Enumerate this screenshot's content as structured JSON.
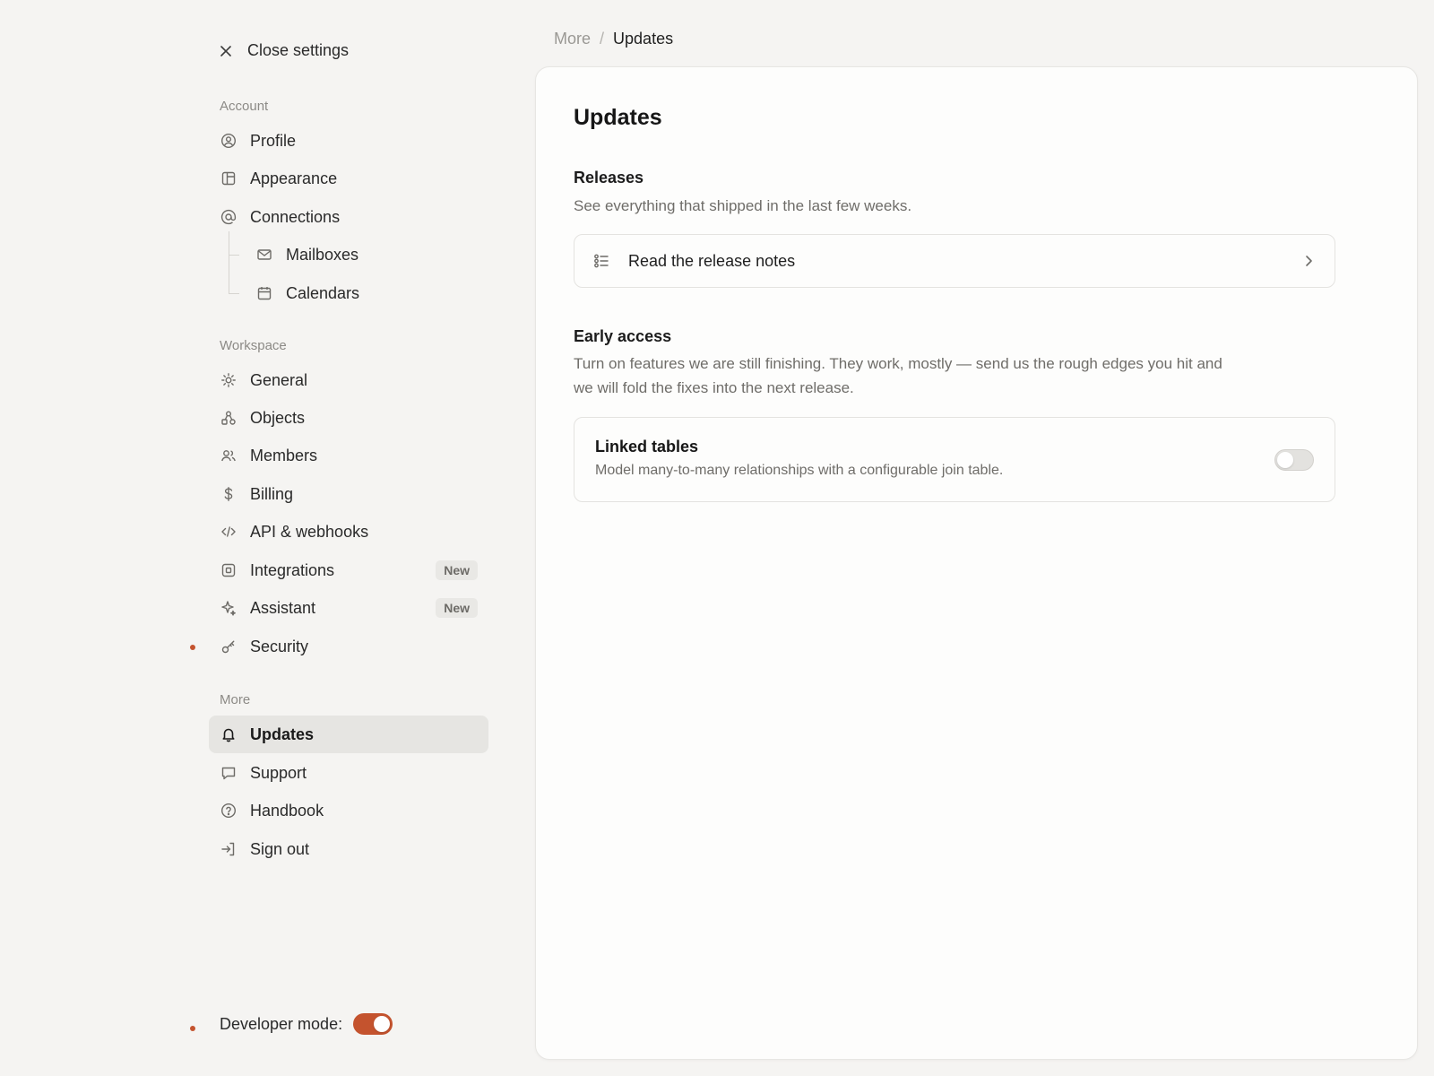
{
  "sidebar": {
    "close_label": "Close settings",
    "sections": {
      "account": "Account",
      "workspace": "Workspace",
      "more": "More"
    },
    "items": {
      "profile": "Profile",
      "appearance": "Appearance",
      "connections": "Connections",
      "mailboxes": "Mailboxes",
      "calendars": "Calendars",
      "general": "General",
      "objects": "Objects",
      "members": "Members",
      "billing": "Billing",
      "api": "API & webhooks",
      "integrations": "Integrations",
      "assistant": "Assistant",
      "security": "Security",
      "updates": "Updates",
      "support": "Support",
      "handbook": "Handbook",
      "signout": "Sign out"
    },
    "badges": {
      "integrations": "New",
      "assistant": "New"
    },
    "developer_mode": {
      "label": "Developer mode:",
      "enabled": true
    }
  },
  "breadcrumb": {
    "parent": "More",
    "separator": "/",
    "current": "Updates"
  },
  "main": {
    "title": "Updates",
    "releases": {
      "title": "Releases",
      "description": "See everything that shipped in the last few weeks.",
      "link_label": "Read the release notes"
    },
    "early_access": {
      "title": "Early access",
      "description": "Turn on features we are still finishing. They work, mostly — send us the rough edges you hit and we will fold the fixes into the next release.",
      "features": [
        {
          "name": "Linked tables",
          "description": "Model many-to-many relationships with a configurable join table.",
          "enabled": false
        }
      ]
    }
  },
  "colors": {
    "accent": "#c4532e",
    "background": "#f5f4f2",
    "panel": "#fdfdfc",
    "active_item": "#e6e5e2"
  }
}
